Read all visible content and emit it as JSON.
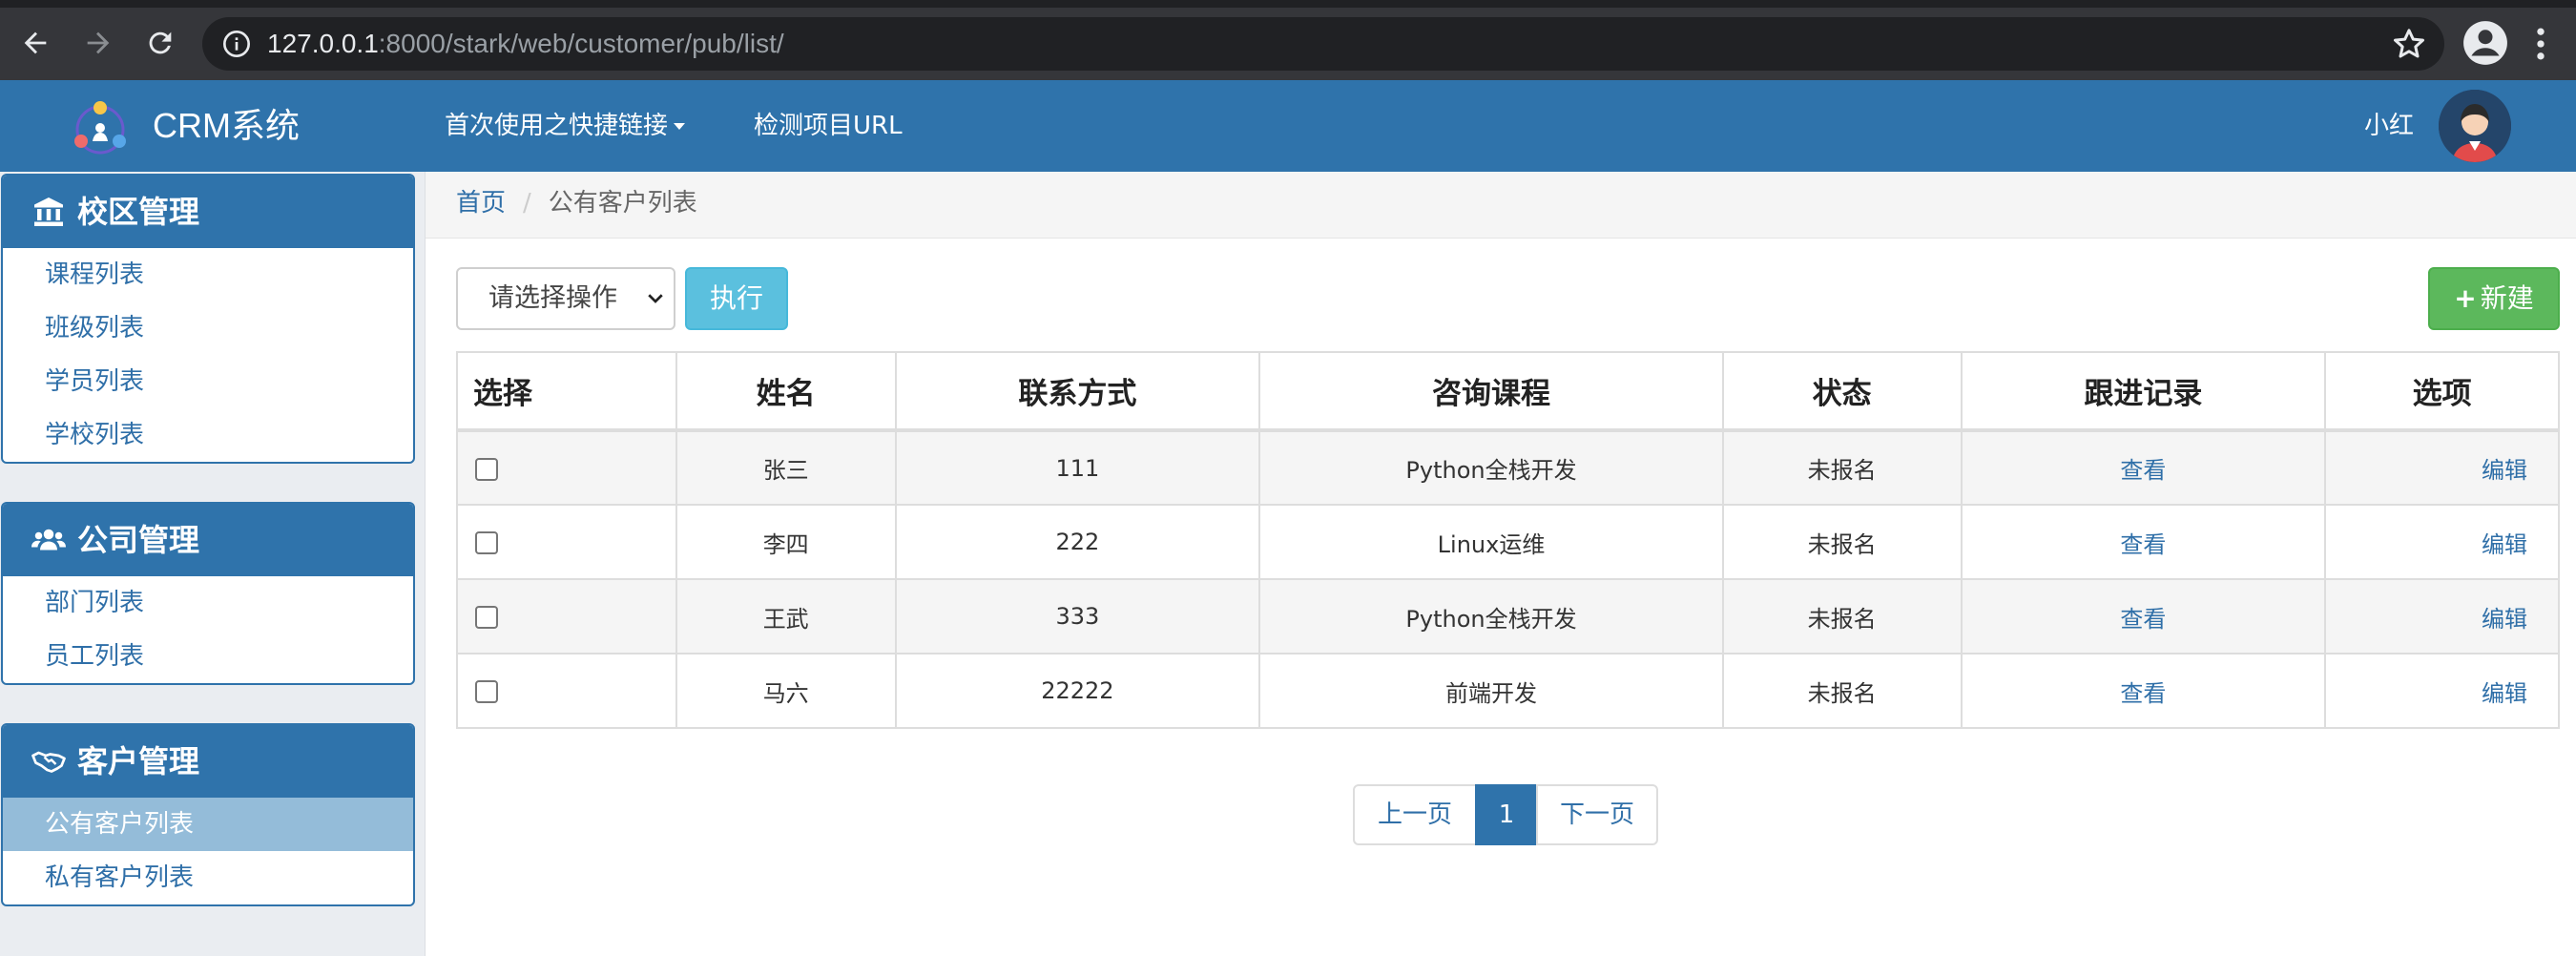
{
  "browser": {
    "url_host": "127.0.0.1",
    "url_rest": ":8000/stark/web/customer/pub/list/"
  },
  "navbar": {
    "brand": "CRM系统",
    "links": [
      "首次使用之快捷链接",
      "检测项目URL"
    ],
    "username": "小红"
  },
  "sidebar": {
    "panels": [
      {
        "title": "校区管理",
        "icon": "bank-icon",
        "items": [
          "课程列表",
          "班级列表",
          "学员列表",
          "学校列表"
        ]
      },
      {
        "title": "公司管理",
        "icon": "users-icon",
        "items": [
          "部门列表",
          "员工列表"
        ]
      },
      {
        "title": "客户管理",
        "icon": "handshake-icon",
        "items": [
          "公有客户列表",
          "私有客户列表"
        ],
        "active_item": "公有客户列表"
      }
    ]
  },
  "breadcrumb": {
    "home": "首页",
    "current": "公有客户列表"
  },
  "toolbar": {
    "select_value": "请选择操作",
    "execute_label": "执行",
    "new_label": "新建"
  },
  "table": {
    "headers": [
      "选择",
      "姓名",
      "联系方式",
      "咨询课程",
      "状态",
      "跟进记录",
      "选项"
    ],
    "rows": [
      {
        "name": "张三",
        "contact": "111",
        "course": "Python全栈开发",
        "status": "未报名",
        "record": "查看",
        "option": "编辑"
      },
      {
        "name": "李四",
        "contact": "222",
        "course": "Linux运维",
        "status": "未报名",
        "record": "查看",
        "option": "编辑"
      },
      {
        "name": "王武",
        "contact": "333",
        "course": "Python全栈开发",
        "status": "未报名",
        "record": "查看",
        "option": "编辑"
      },
      {
        "name": "马六",
        "contact": "22222",
        "course": "前端开发",
        "status": "未报名",
        "record": "查看",
        "option": "编辑"
      }
    ]
  },
  "pagination": {
    "prev": "上一页",
    "current": "1",
    "next": "下一页"
  },
  "colors": {
    "primary": "#2f73ab",
    "info": "#5bc0de",
    "success": "#5cb85c",
    "link": "#2f6fa8"
  }
}
